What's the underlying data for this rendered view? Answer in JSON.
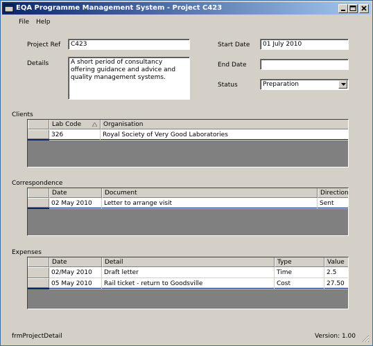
{
  "window": {
    "title": "EQA Programme Management System - Project C423"
  },
  "menu": {
    "file": "File",
    "help": "Help"
  },
  "form": {
    "project_ref_label": "Project Ref",
    "project_ref_value": "C423",
    "details_label": "Details",
    "details_value": "A short period of consultancy offering guidance and advice and quality management systems.",
    "start_date_label": "Start Date",
    "start_date_value": "01 July 2010",
    "end_date_label": "End Date",
    "end_date_value": "",
    "status_label": "Status",
    "status_value": "Preparation"
  },
  "clients": {
    "title": "Clients",
    "headers": [
      "Lab Code",
      "Organisation"
    ],
    "rows": [
      [
        "326",
        "Royal Society of Very Good Laboratories"
      ]
    ]
  },
  "correspondence": {
    "title": "Correspondence",
    "headers": [
      "Date",
      "Document",
      "Direction"
    ],
    "rows": [
      [
        "02 May 2010",
        "Letter to arrange visit",
        "Sent"
      ]
    ]
  },
  "expenses": {
    "title": "Expenses",
    "headers": [
      "Date",
      "Detail",
      "Type",
      "Value"
    ],
    "rows": [
      [
        "02/May 2010",
        "Draft letter",
        "Time",
        "2.5"
      ],
      [
        "05 May 2010",
        "Rail ticket - return to Goodsville",
        "Cost",
        "27.50"
      ]
    ]
  },
  "status_bar": {
    "form_name": "frmProjectDetail",
    "version": "Version: 1.00"
  },
  "colors": {
    "title_gradient_start": "#0a246a",
    "title_gradient_end": "#a6caf0",
    "face": "#d4d0c8",
    "grid_bg": "#808080"
  }
}
